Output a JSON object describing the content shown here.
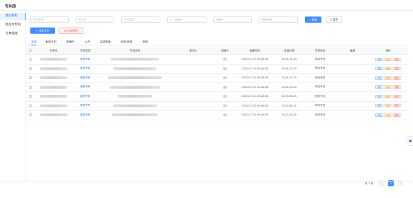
{
  "header": {
    "title": "专利库"
  },
  "sidebar": {
    "items": [
      {
        "label": "我的专利",
        "active": true
      },
      {
        "label": "智库文专利",
        "active": false
      },
      {
        "label": "学界管理",
        "active": false
      }
    ]
  },
  "filters": {
    "patent_name_placeholder": "专利名称",
    "patent_no_placeholder": "专利号",
    "patent_type_placeholder": "专利类型",
    "apply_date_placeholder": "申请日",
    "creator_placeholder": "创建人",
    "data_source_placeholder": "数据来源",
    "search_label": "查询",
    "reset_label": "重置"
  },
  "toolbar": {
    "add_label": "添加专利",
    "batch_delete_label": "批量删除"
  },
  "tabs": [
    {
      "label": "全部",
      "active": true
    },
    {
      "label": "有效专利",
      "active": false
    },
    {
      "label": "申请中",
      "active": false
    },
    {
      "label": "公开",
      "active": false
    },
    {
      "label": "实质审查",
      "active": false
    },
    {
      "label": "无效/失效",
      "active": false
    },
    {
      "label": "其他",
      "active": false
    }
  ],
  "table": {
    "columns": [
      "专利号",
      "专利类型",
      "专利名称",
      "权利人",
      "创建人",
      "创建时间",
      "申请日期",
      "专利状态",
      "来源",
      "操作"
    ],
    "rows": [
      {
        "type": "新型专利",
        "created": "2023-07-19 06:48:38",
        "apply_date": "2018-11-23",
        "status": "有效专利"
      },
      {
        "type": "新型专利",
        "created": "2023-07-19 06:48:38",
        "apply_date": "2018-11-23",
        "status": "有效专利"
      },
      {
        "type": "新型专利",
        "created": "2023-07-19 06:48:38",
        "apply_date": "2018-11-23",
        "status": "有效专利"
      },
      {
        "type": "新型专利",
        "created": "2023-07-19 06:48:38",
        "apply_date": "2018-12-29",
        "status": "有效专利"
      },
      {
        "type": "新型专利",
        "created": "2023-07-19 06:48:38",
        "apply_date": "2019-06-03",
        "status": "有效专利"
      },
      {
        "type": "新型专利",
        "created": "2023-07-19 06:48:38",
        "apply_date": "2019-06-12",
        "status": "有效专利"
      },
      {
        "type": "新型专利",
        "created": "2023-07-19 06:48:38",
        "apply_date": "2021-02-26",
        "status": "有效专利"
      }
    ],
    "actions": {
      "detail": "详情",
      "edit": "编辑",
      "delete": "删除"
    }
  },
  "pagination": {
    "total_text": "共 7 条",
    "current_page": "1",
    "prev": "‹",
    "next": "›"
  },
  "colors": {
    "primary": "#3d8eff",
    "danger": "#f56c6c",
    "warning": "#e6a23c"
  }
}
